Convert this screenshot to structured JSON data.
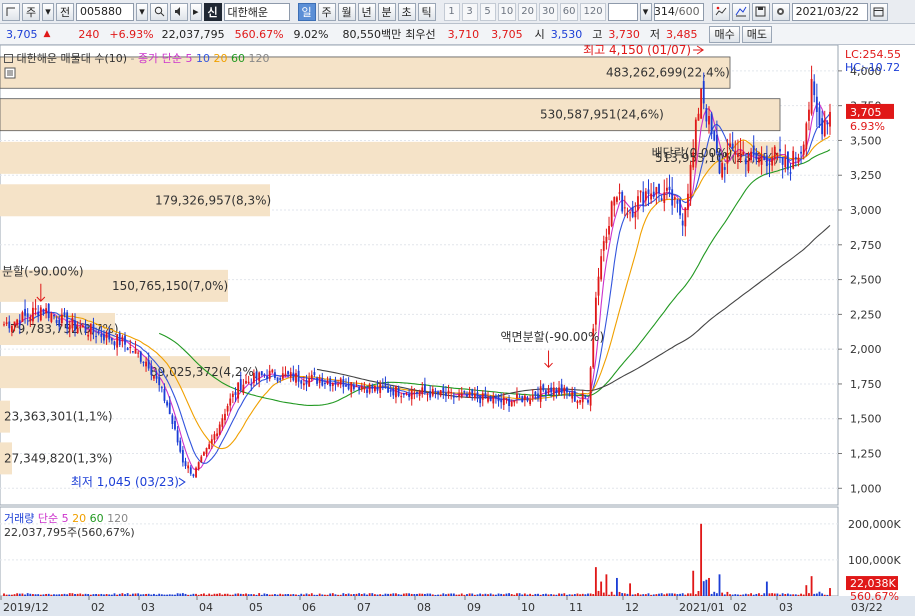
{
  "toolbar": {
    "kind_label": "주",
    "prev_label": "전",
    "code_value": "005880",
    "stock_badge": "신",
    "stock_name": "대한해운",
    "periods": [
      "일",
      "주",
      "월",
      "년",
      "분",
      "초",
      "틱"
    ],
    "active_period": "일",
    "minutes": [
      "1",
      "3",
      "5",
      "10",
      "20",
      "30",
      "60",
      "120"
    ],
    "count_value": "314",
    "count_total": "/600",
    "date_value": "2021/03/22",
    "icons": [
      "search-icon",
      "speaker-icon",
      "chart-compare-icon",
      "line-tool-icon",
      "save-icon",
      "settings-icon",
      "calendar-icon"
    ]
  },
  "quote": {
    "price": "3,705",
    "change": "240",
    "change_rate": "+6.93%",
    "volume": "22,037,795",
    "volume_rate": "560.67%",
    "turnover": "9.02%",
    "amount": "80,550백만",
    "best_label": "최우선",
    "best_sell": "3,710",
    "best_buy": "3,705",
    "open_label": "시",
    "open": "3,530",
    "high_label": "고",
    "high": "3,730",
    "low_label": "저",
    "low": "3,485",
    "buy_button": "매수",
    "sell_button": "매도"
  },
  "price_panel": {
    "legend_title": "대한해운 매물대 수(10)",
    "ma_label": "종가 단순",
    "ma_periods": [
      "5",
      "10",
      "20",
      "60",
      "120"
    ],
    "lc_label": "LC:254.55",
    "hc_label": "HC:-10.72",
    "current_price": "3,705",
    "current_rate": "6.93%",
    "max_label": "최고 4,150 (01/07)",
    "min_label": "최저 1,045 (03/23)",
    "split_label": "액면분할(-90.00%)",
    "split_label_left": "분할(-90.00%)",
    "dividend_label": "배당락(0.00%)",
    "colors": {
      "up": "#e01818",
      "down": "#1c3ed6",
      "ma5": "#cc33cc",
      "ma10": "#3355dd",
      "ma20": "#f0a000",
      "ma60": "#229922",
      "ma120": "#444444",
      "profile": "#f5e3c8"
    }
  },
  "volume_panel": {
    "legend_title": "거래량",
    "ma_label": "단순",
    "ma_periods": [
      "5",
      "20",
      "60",
      "120"
    ],
    "volume_text": "22,037,795주(560,67%)",
    "current_volume": "22,038K",
    "current_rate": "560.67%"
  },
  "x_axis": [
    "2019/12",
    "02",
    "03",
    "04",
    "05",
    "06",
    "07",
    "08",
    "09",
    "10",
    "11",
    "12",
    "2021/01",
    "02",
    "03"
  ],
  "x_axis_right": "03/22",
  "chart_data": {
    "type": "candlestick",
    "y_ticks": [
      1000,
      1250,
      1500,
      1750,
      2000,
      2250,
      2500,
      2750,
      3000,
      3250,
      3500,
      3750,
      4000
    ],
    "y_tick_labels": [
      "1,000",
      "1,250",
      "1,500",
      "1,750",
      "2,000",
      "2,250",
      "2,500",
      "2,750",
      "3,000",
      "3,250",
      "3,500",
      "3,750",
      "4,000"
    ],
    "ylim": [
      880,
      4150
    ],
    "volume_ticks": [
      "100,000K",
      "200,000K"
    ],
    "volume_ylim": [
      0,
      230000000
    ],
    "volume_profile": [
      {
        "label": "27,349,820(1,3%)",
        "price_low": 1100,
        "price_high": 1330
      },
      {
        "label": "23,363,301(1,1%)",
        "price_low": 1400,
        "price_high": 1630
      },
      {
        "label": "89,025,372(4,2%)",
        "price_low": 1720,
        "price_high": 1950
      },
      {
        "label": "79,783,752(3,7%)",
        "price_low": 2030,
        "price_high": 2260
      },
      {
        "label": "150,765,150(7,0%)",
        "price_low": 2340,
        "price_high": 2570
      },
      {
        "label": "",
        "price_low": 2650,
        "price_high": 2870
      },
      {
        "label": "179,326,957(8,3%)",
        "price_low": 2955,
        "price_high": 3185
      },
      {
        "label": "513,953,105(23,9%)",
        "price_low": 3260,
        "price_high": 3490
      },
      {
        "label": "530,587,951(24,6%)",
        "price_low": 3570,
        "price_high": 3800
      },
      {
        "label": "483,262,699(22,4%)",
        "price_low": 3875,
        "price_high": 4100
      }
    ],
    "price_anchors": [
      [
        0,
        2180
      ],
      [
        8,
        2230
      ],
      [
        14,
        2300
      ],
      [
        22,
        2200
      ],
      [
        35,
        2120
      ],
      [
        45,
        2050
      ],
      [
        55,
        1900
      ],
      [
        62,
        1600
      ],
      [
        68,
        1200
      ],
      [
        72,
        1100
      ],
      [
        78,
        1300
      ],
      [
        85,
        1600
      ],
      [
        90,
        1750
      ],
      [
        100,
        1820
      ],
      [
        110,
        1800
      ],
      [
        120,
        1780
      ],
      [
        130,
        1760
      ],
      [
        140,
        1720
      ],
      [
        150,
        1700
      ],
      [
        160,
        1690
      ],
      [
        170,
        1660
      ],
      [
        180,
        1650
      ],
      [
        190,
        1620
      ],
      [
        200,
        1660
      ],
      [
        207,
        1720
      ],
      [
        212,
        1700
      ],
      [
        218,
        1640
      ],
      [
        222,
        1650
      ],
      [
        225,
        2400
      ],
      [
        228,
        2800
      ],
      [
        232,
        3100
      ],
      [
        238,
        3000
      ],
      [
        245,
        3150
      ],
      [
        252,
        3100
      ],
      [
        258,
        2950
      ],
      [
        262,
        3400
      ],
      [
        265,
        3900
      ],
      [
        268,
        3600
      ],
      [
        272,
        3300
      ],
      [
        278,
        3450
      ],
      [
        285,
        3350
      ],
      [
        292,
        3400
      ],
      [
        298,
        3300
      ],
      [
        303,
        3450
      ],
      [
        307,
        3850
      ],
      [
        310,
        3600
      ],
      [
        314,
        3705
      ]
    ],
    "volume_spikes": [
      [
        225,
        80000000
      ],
      [
        227,
        40000000
      ],
      [
        229,
        60000000
      ],
      [
        233,
        50000000
      ],
      [
        238,
        35000000
      ],
      [
        262,
        70000000
      ],
      [
        265,
        200000000
      ],
      [
        268,
        50000000
      ],
      [
        272,
        60000000
      ],
      [
        290,
        40000000
      ],
      [
        305,
        30000000
      ],
      [
        307,
        55000000
      ],
      [
        314,
        22038000
      ]
    ]
  }
}
